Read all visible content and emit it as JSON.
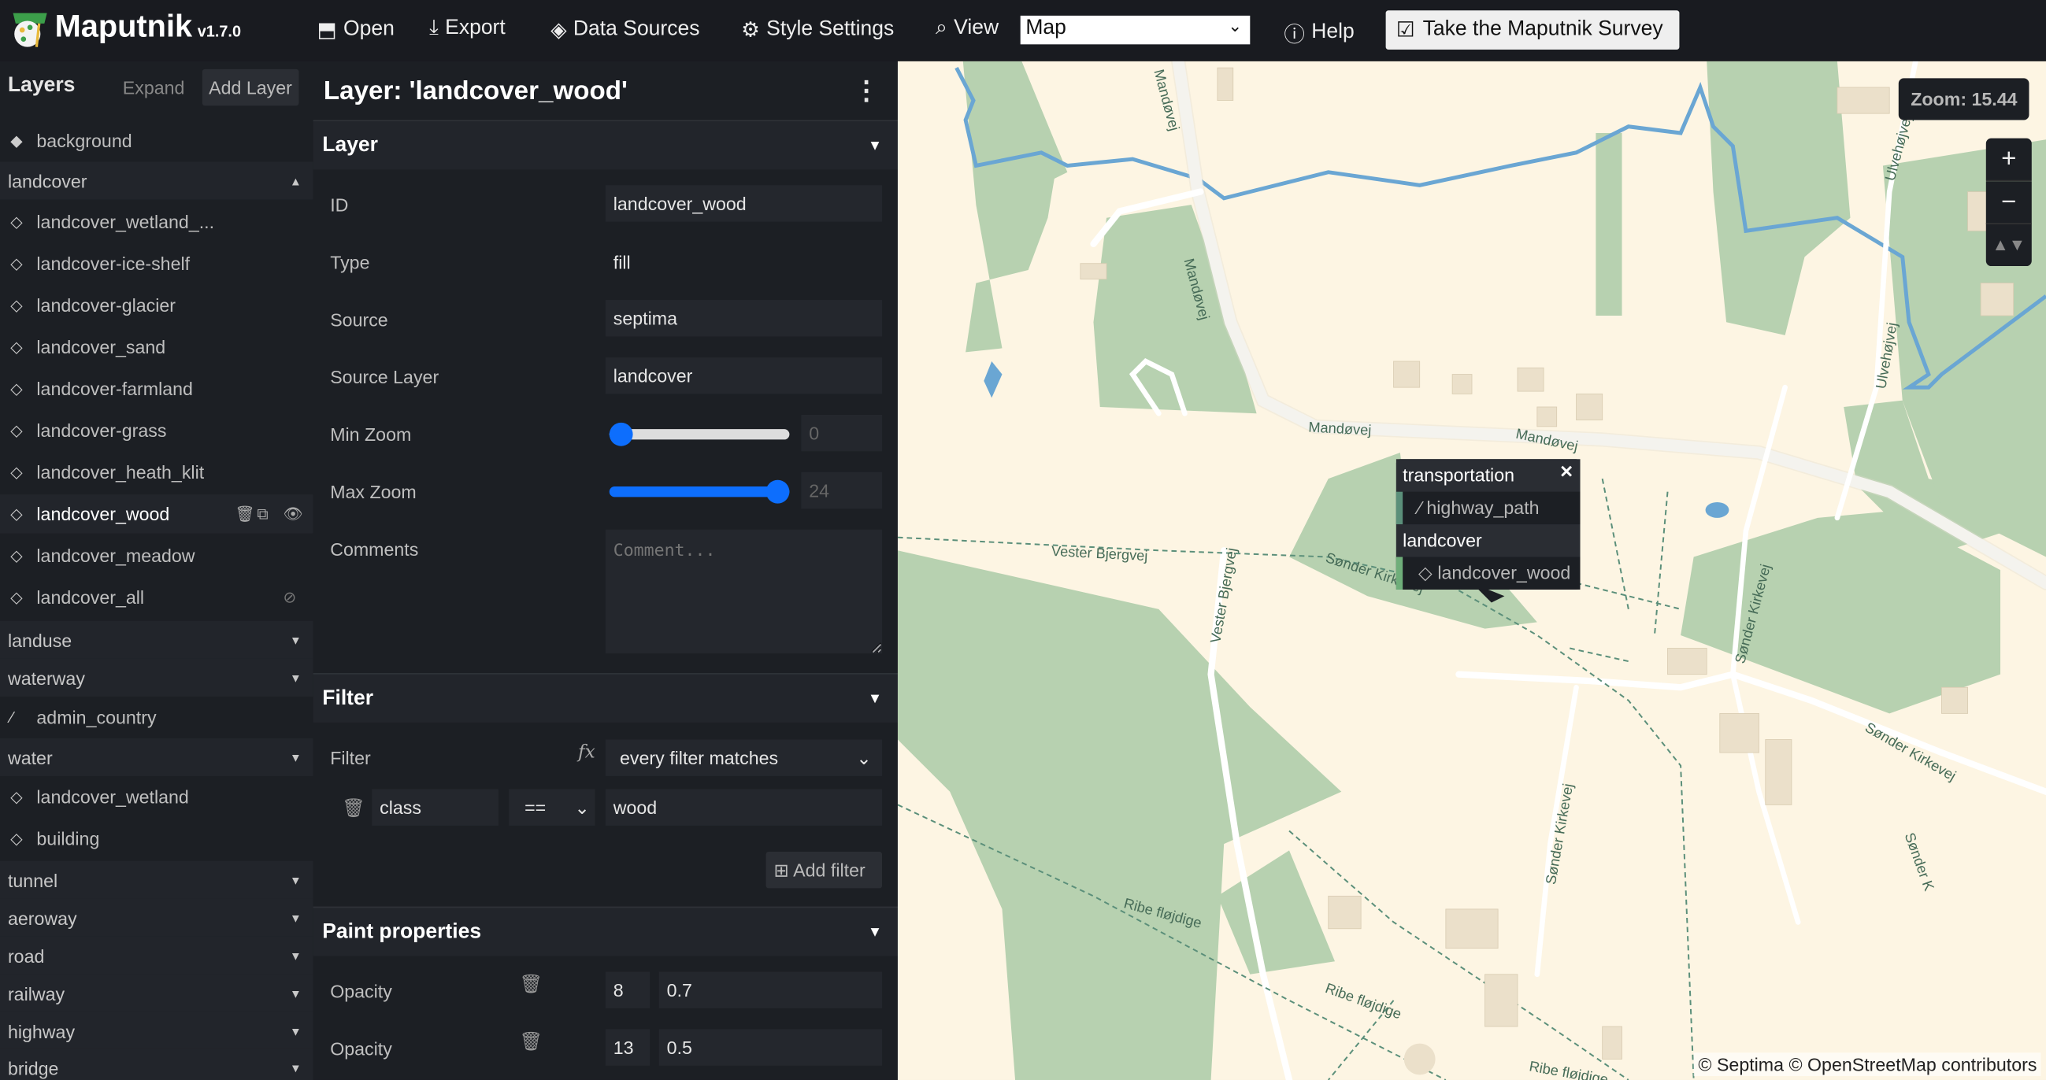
{
  "app": {
    "name": "Maputnik",
    "version": "v1.7.0"
  },
  "nav": {
    "open": "Open",
    "export": "Export",
    "data_sources": "Data Sources",
    "style_settings": "Style Settings",
    "view": "View",
    "view_value": "Map",
    "help": "Help",
    "survey": "Take the Maputnik Survey"
  },
  "layers_panel": {
    "title": "Layers",
    "expand": "Expand",
    "add_layer": "Add Layer",
    "rows": [
      {
        "label": "background",
        "kind": "item",
        "icon": "background"
      },
      {
        "label": "landcover",
        "kind": "group",
        "open": true
      },
      {
        "label": "landcover_wetland_...",
        "kind": "item",
        "icon": "fill"
      },
      {
        "label": "landcover-ice-shelf",
        "kind": "item",
        "icon": "fill"
      },
      {
        "label": "landcover-glacier",
        "kind": "item",
        "icon": "fill"
      },
      {
        "label": "landcover_sand",
        "kind": "item",
        "icon": "fill"
      },
      {
        "label": "landcover-farmland",
        "kind": "item",
        "icon": "fill"
      },
      {
        "label": "landcover-grass",
        "kind": "item",
        "icon": "fill"
      },
      {
        "label": "landcover_heath_klit",
        "kind": "item",
        "icon": "fill"
      },
      {
        "label": "landcover_wood",
        "kind": "item",
        "icon": "fill",
        "selected": true
      },
      {
        "label": "landcover_meadow",
        "kind": "item",
        "icon": "fill"
      },
      {
        "label": "landcover_all",
        "kind": "item",
        "icon": "fill",
        "hidden": true
      },
      {
        "label": "landuse",
        "kind": "group"
      },
      {
        "label": "waterway",
        "kind": "group"
      },
      {
        "label": "admin_country",
        "kind": "item",
        "icon": "line"
      },
      {
        "label": "water",
        "kind": "group"
      },
      {
        "label": "landcover_wetland",
        "kind": "item",
        "icon": "fill"
      },
      {
        "label": "building",
        "kind": "item",
        "icon": "fill"
      },
      {
        "label": "tunnel",
        "kind": "group"
      },
      {
        "label": "aeroway",
        "kind": "group"
      },
      {
        "label": "road",
        "kind": "group"
      },
      {
        "label": "railway",
        "kind": "group"
      },
      {
        "label": "highway",
        "kind": "group"
      },
      {
        "label": "bridge",
        "kind": "group"
      }
    ]
  },
  "editor": {
    "title": "Layer: 'landcover_wood'",
    "layer_section": "Layer",
    "fields": {
      "id_label": "ID",
      "id": "landcover_wood",
      "type_label": "Type",
      "type": "fill",
      "source_label": "Source",
      "source": "septima",
      "source_layer_label": "Source Layer",
      "source_layer": "landcover",
      "min_zoom_label": "Min Zoom",
      "min_zoom": "0",
      "max_zoom_label": "Max Zoom",
      "max_zoom": "24",
      "comments_label": "Comments",
      "comments_placeholder": "Comment..."
    },
    "filter_section": "Filter",
    "filter": {
      "label": "Filter",
      "mode": "every filter matches",
      "key": "class",
      "op": "==",
      "value": "wood",
      "add": "Add filter"
    },
    "paint_section": "Paint properties",
    "paint": [
      {
        "label": "Opacity",
        "zoom": "8",
        "value": "0.7"
      },
      {
        "label": "Opacity",
        "zoom": "13",
        "value": "0.5"
      }
    ]
  },
  "map": {
    "zoom_label": "Zoom: 15.44",
    "attribution": "© Septima © OpenStreetMap contributors",
    "labels": {
      "l1": "Mandøvej",
      "l2": "Mandøvej",
      "l3": "Mandøvej",
      "l4": "Mandøvej",
      "l5": "Vester Bjergvej",
      "l6": "Vester Bjergvej",
      "l7": "Sønder Kirkevej",
      "l8": "Sønder Kirkevej",
      "l9": "Sønder Kirkevej",
      "l10": "Sønder Kirkevej",
      "l11": "Ribe fløjdige",
      "l12": "Ribe fløjdige",
      "l13": "Ribe fløjdige",
      "l14": "Ulvehøjvej",
      "l15": "Ulvehøjvej",
      "l16": "Sønder K"
    },
    "popup": {
      "group1": "transportation",
      "item1": "highway_path",
      "group2": "landcover",
      "item2": "landcover_wood"
    },
    "colors": {
      "land": "#fdf5e3",
      "wood": "#b7d1b0",
      "water": "#6aa6d3",
      "road": "#ffffff",
      "building": "#ebe0ca"
    }
  }
}
